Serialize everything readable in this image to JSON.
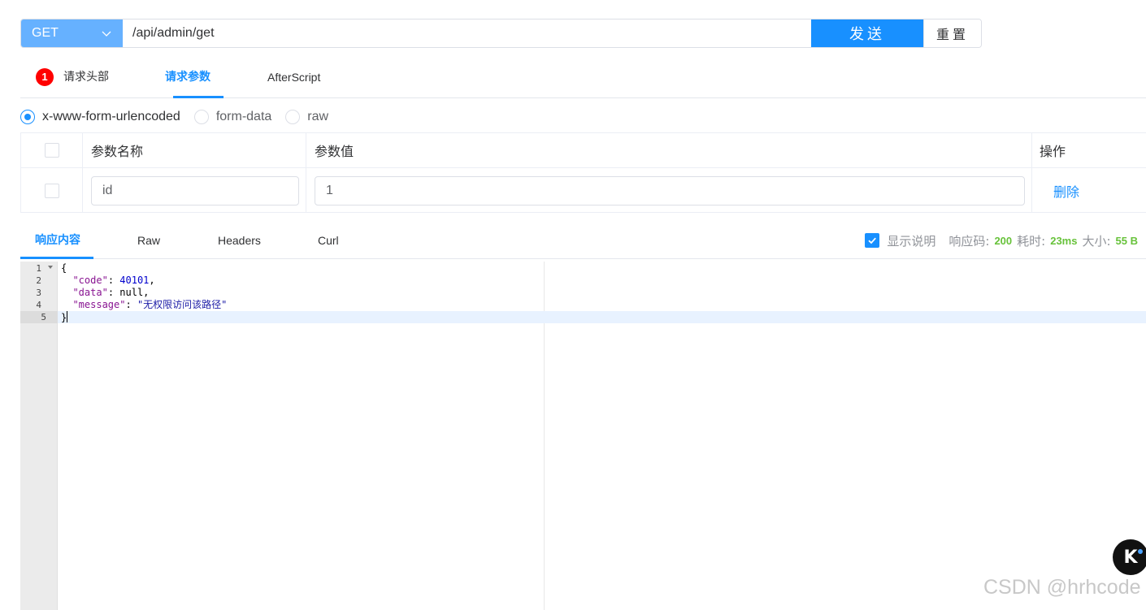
{
  "request": {
    "method": "GET",
    "url": "/api/admin/get",
    "send_label": "发送",
    "reset_label": "重置"
  },
  "request_tabs": {
    "headers_badge": "1",
    "headers_label": "请求头部",
    "params_label": "请求参数",
    "afterscript_label": "AfterScript"
  },
  "body_type": {
    "options": [
      "x-www-form-urlencoded",
      "form-data",
      "raw"
    ],
    "selected": "x-www-form-urlencoded"
  },
  "params_table": {
    "col_name": "参数名称",
    "col_value": "参数值",
    "col_op": "操作",
    "rows": [
      {
        "name": "id",
        "value": "1",
        "action": "删除"
      }
    ]
  },
  "response_tabs": {
    "content_label": "响应内容",
    "raw_label": "Raw",
    "headers_label": "Headers",
    "curl_label": "Curl"
  },
  "response_meta": {
    "show_desc_label": "显示说明",
    "status_label": "响应码:",
    "status_value": "200",
    "time_label": "耗时:",
    "time_value": "23ms",
    "size_label": "大小:",
    "size_value": "55 B"
  },
  "response_body": {
    "line_numbers": [
      "1",
      "2",
      "3",
      "4",
      "5"
    ],
    "open_brace": "{",
    "close_brace": "}",
    "code_key": "\"code\"",
    "code_value": "40101",
    "data_key": "\"data\"",
    "data_value": "null",
    "message_key": "\"message\"",
    "message_value": "\"无权限访问该路径\""
  },
  "watermark": {
    "text": "CSDN @hrhcode",
    "logo_letter": "K"
  },
  "colors": {
    "primary": "#1890ff",
    "method_bg": "#66b1ff",
    "success": "#67c23a",
    "badge": "#ff0000"
  }
}
